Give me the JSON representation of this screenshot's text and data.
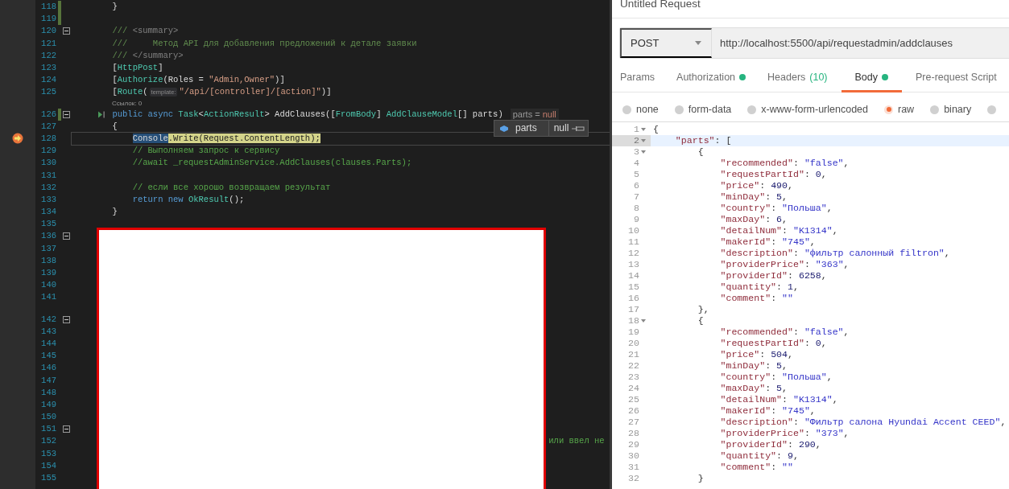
{
  "editor": {
    "lines": [
      {
        "number": "118",
        "changed": true,
        "fold": false,
        "current": false,
        "tokens": [
          {
            "kind": "plain",
            "text": "        }"
          }
        ]
      },
      {
        "number": "119",
        "changed": true,
        "fold": false,
        "current": false
      },
      {
        "number": "120",
        "changed": false,
        "fold": true,
        "current": false,
        "tokens": [
          {
            "kind": "doc",
            "text": "        ///"
          },
          {
            "kind": "doctag",
            "text": " <summary>"
          }
        ]
      },
      {
        "number": "121",
        "changed": false,
        "fold": false,
        "current": false,
        "tokens": [
          {
            "kind": "doc",
            "text": "        ///     Метод API для добавления предложений к детале заявки"
          }
        ]
      },
      {
        "number": "122",
        "changed": false,
        "fold": false,
        "current": false,
        "tokens": [
          {
            "kind": "doc",
            "text": "        ///"
          },
          {
            "kind": "doctag",
            "text": " </summary>"
          }
        ]
      },
      {
        "number": "123",
        "changed": false,
        "fold": false,
        "current": false,
        "tokens": [
          {
            "kind": "plain",
            "text": "        ["
          },
          {
            "kind": "type",
            "text": "HttpPost"
          },
          {
            "kind": "plain",
            "text": "]"
          }
        ]
      },
      {
        "number": "124",
        "changed": false,
        "fold": false,
        "current": false,
        "tokens": [
          {
            "kind": "plain",
            "text": "        ["
          },
          {
            "kind": "type",
            "text": "Authorize"
          },
          {
            "kind": "plain",
            "text": "(Roles = "
          },
          {
            "kind": "string",
            "text": "\"Admin,Owner\""
          },
          {
            "kind": "plain",
            "text": ")]"
          }
        ]
      },
      {
        "number": "125",
        "changed": false,
        "fold": false,
        "current": false,
        "tokens": [
          {
            "kind": "plain",
            "text": "        ["
          },
          {
            "kind": "type",
            "text": "Route"
          },
          {
            "kind": "plain",
            "text": "("
          },
          {
            "kind": "param-hint",
            "text": "template:"
          },
          {
            "kind": "string",
            "text": "\"/api/[controller]/[action]\""
          },
          {
            "kind": "plain",
            "text": ")]"
          }
        ]
      },
      {
        "number": "126",
        "changed": true,
        "fold": true,
        "current": false,
        "lens": "Ссылок: 0",
        "run_icon": true,
        "tokens": [
          {
            "kind": "keyword",
            "text": "        public async "
          },
          {
            "kind": "type",
            "text": "Task"
          },
          {
            "kind": "plain",
            "text": "<"
          },
          {
            "kind": "type",
            "text": "ActionResult"
          },
          {
            "kind": "plain",
            "text": "> AddClauses(["
          },
          {
            "kind": "type",
            "text": "FromBody"
          },
          {
            "kind": "plain",
            "text": "] "
          },
          {
            "kind": "type",
            "text": "AddClauseModel"
          },
          {
            "kind": "plain",
            "text": "[] parts)"
          },
          {
            "kind": "value-hint-name",
            "text": "parts = "
          },
          {
            "kind": "value-hint-null",
            "text": "null"
          }
        ]
      },
      {
        "number": "127",
        "changed": false,
        "fold": false,
        "current": false,
        "tokens": [
          {
            "kind": "plain",
            "text": "        {"
          }
        ]
      },
      {
        "number": "128",
        "changed": false,
        "fold": false,
        "current": true,
        "tokens": [
          {
            "kind": "selected",
            "text": "            Console"
          },
          {
            "kind": "statement",
            "text": ".Write(Request.ContentLength);"
          }
        ]
      },
      {
        "number": "129",
        "changed": false,
        "fold": false,
        "current": false,
        "tokens": [
          {
            "kind": "comment",
            "text": "            // Выполняем запрос к сервису"
          }
        ]
      },
      {
        "number": "130",
        "changed": false,
        "fold": false,
        "current": false,
        "tokens": [
          {
            "kind": "comment",
            "text": "            //await _requestAdminService.AddClauses(clauses.Parts);"
          }
        ]
      },
      {
        "number": "131",
        "changed": false,
        "fold": false,
        "current": false
      },
      {
        "number": "132",
        "changed": false,
        "fold": false,
        "current": false,
        "tokens": [
          {
            "kind": "comment",
            "text": "            // если все хорошо возвращаем результат"
          }
        ]
      },
      {
        "number": "133",
        "changed": false,
        "fold": false,
        "current": false,
        "tokens": [
          {
            "kind": "keyword",
            "text": "            return new "
          },
          {
            "kind": "type",
            "text": "OkResult"
          },
          {
            "kind": "plain",
            "text": "();"
          }
        ]
      },
      {
        "number": "134",
        "changed": false,
        "fold": false,
        "current": false,
        "tokens": [
          {
            "kind": "plain",
            "text": "        }"
          }
        ]
      },
      {
        "number": "135",
        "changed": false,
        "fold": false,
        "current": false
      },
      {
        "number": "136",
        "changed": false,
        "fold": true,
        "current": false
      },
      {
        "number": "137",
        "changed": false,
        "fold": false,
        "current": false
      },
      {
        "number": "138",
        "changed": false,
        "fold": false,
        "current": false
      },
      {
        "number": "139",
        "changed": false,
        "fold": false,
        "current": false
      },
      {
        "number": "140",
        "changed": false,
        "fold": false,
        "current": false
      },
      {
        "number": "141",
        "changed": false,
        "fold": false,
        "current": false
      },
      {
        "number": "142",
        "changed": false,
        "fold": true,
        "current": false,
        "lens_hidden": true
      },
      {
        "number": "143",
        "changed": false,
        "fold": false,
        "current": false
      },
      {
        "number": "144",
        "changed": false,
        "fold": false,
        "current": false
      },
      {
        "number": "145",
        "changed": false,
        "fold": false,
        "current": false
      },
      {
        "number": "146",
        "changed": false,
        "fold": false,
        "current": false
      },
      {
        "number": "147",
        "changed": false,
        "fold": false,
        "current": false
      },
      {
        "number": "148",
        "changed": false,
        "fold": false,
        "current": false
      },
      {
        "number": "149",
        "changed": false,
        "fold": false,
        "current": false
      },
      {
        "number": "150",
        "changed": false,
        "fold": false,
        "current": false
      },
      {
        "number": "151",
        "changed": false,
        "fold": true,
        "current": false
      },
      {
        "number": "152",
        "changed": false,
        "fold": false,
        "current": false,
        "tokens": [
          {
            "kind": "comment",
            "text": "                                                                                              или ввел не"
          }
        ]
      },
      {
        "number": "153",
        "changed": false,
        "fold": false,
        "current": false
      },
      {
        "number": "154",
        "changed": false,
        "fold": false,
        "current": false
      },
      {
        "number": "155",
        "changed": false,
        "fold": false,
        "current": false
      }
    ],
    "datatip": {
      "name": "parts",
      "value": "null"
    }
  },
  "request": {
    "title": "Untitled Request",
    "method": "POST",
    "url": "http://localhost:5500/api/requestadmin/addclauses",
    "tabs": [
      {
        "label": "Params",
        "selected": false,
        "indicator": false
      },
      {
        "label": "Authorization",
        "selected": false,
        "indicator": true
      },
      {
        "label": "Headers",
        "count": "(10)",
        "selected": false,
        "indicator": false
      },
      {
        "label": "Body",
        "selected": true,
        "indicator": true
      },
      {
        "label": "Pre-request Script",
        "selected": false,
        "indicator": false
      }
    ],
    "body_types": [
      {
        "label": "none",
        "selected": false
      },
      {
        "label": "form-data",
        "selected": false
      },
      {
        "label": "x-www-form-urlencoded",
        "selected": false
      },
      {
        "label": "raw",
        "selected": true
      },
      {
        "label": "binary",
        "selected": false
      },
      {
        "selected": false
      }
    ],
    "body": [
      {
        "number": "1",
        "fold": true,
        "active": false,
        "tokens": [
          {
            "kind": "punct",
            "text": "{"
          }
        ]
      },
      {
        "number": "2",
        "fold": true,
        "active": true,
        "tokens": [
          {
            "kind": "key",
            "text": "    \"parts\""
          },
          {
            "kind": "punct",
            "text": ": ["
          }
        ]
      },
      {
        "number": "3",
        "fold": true,
        "active": false,
        "tokens": [
          {
            "kind": "punct",
            "text": "        {"
          }
        ]
      },
      {
        "number": "4",
        "fold": false,
        "active": false,
        "tokens": [
          {
            "kind": "key",
            "text": "            \"recommended\""
          },
          {
            "kind": "punct",
            "text": ": "
          },
          {
            "kind": "str",
            "text": "\"false\""
          },
          {
            "kind": "punct",
            "text": ","
          }
        ]
      },
      {
        "number": "5",
        "fold": false,
        "active": false,
        "tokens": [
          {
            "kind": "key",
            "text": "            \"requestPartId\""
          },
          {
            "kind": "punct",
            "text": ": "
          },
          {
            "kind": "num",
            "text": "0"
          },
          {
            "kind": "punct",
            "text": ","
          }
        ]
      },
      {
        "number": "6",
        "fold": false,
        "active": false,
        "tokens": [
          {
            "kind": "key",
            "text": "            \"price\""
          },
          {
            "kind": "punct",
            "text": ": "
          },
          {
            "kind": "num",
            "text": "490"
          },
          {
            "kind": "punct",
            "text": ","
          }
        ]
      },
      {
        "number": "7",
        "fold": false,
        "active": false,
        "tokens": [
          {
            "kind": "key",
            "text": "            \"minDay\""
          },
          {
            "kind": "punct",
            "text": ": "
          },
          {
            "kind": "num",
            "text": "5"
          },
          {
            "kind": "punct",
            "text": ","
          }
        ]
      },
      {
        "number": "8",
        "fold": false,
        "active": false,
        "tokens": [
          {
            "kind": "key",
            "text": "            \"country\""
          },
          {
            "kind": "punct",
            "text": ": "
          },
          {
            "kind": "str",
            "text": "\"Польша\""
          },
          {
            "kind": "punct",
            "text": ","
          }
        ]
      },
      {
        "number": "9",
        "fold": false,
        "active": false,
        "tokens": [
          {
            "kind": "key",
            "text": "            \"maxDay\""
          },
          {
            "kind": "punct",
            "text": ": "
          },
          {
            "kind": "num",
            "text": "6"
          },
          {
            "kind": "punct",
            "text": ","
          }
        ]
      },
      {
        "number": "10",
        "fold": false,
        "active": false,
        "tokens": [
          {
            "kind": "key",
            "text": "            \"detailNum\""
          },
          {
            "kind": "punct",
            "text": ": "
          },
          {
            "kind": "str",
            "text": "\"K1314\""
          },
          {
            "kind": "punct",
            "text": ","
          }
        ]
      },
      {
        "number": "11",
        "fold": false,
        "active": false,
        "tokens": [
          {
            "kind": "key",
            "text": "            \"makerId\""
          },
          {
            "kind": "punct",
            "text": ": "
          },
          {
            "kind": "str",
            "text": "\"745\""
          },
          {
            "kind": "punct",
            "text": ","
          }
        ]
      },
      {
        "number": "12",
        "fold": false,
        "active": false,
        "tokens": [
          {
            "kind": "key",
            "text": "            \"description\""
          },
          {
            "kind": "punct",
            "text": ": "
          },
          {
            "kind": "str",
            "text": "\"фильтр салонный filtron\""
          },
          {
            "kind": "punct",
            "text": ","
          }
        ]
      },
      {
        "number": "13",
        "fold": false,
        "active": false,
        "tokens": [
          {
            "kind": "key",
            "text": "            \"providerPrice\""
          },
          {
            "kind": "punct",
            "text": ": "
          },
          {
            "kind": "str",
            "text": "\"363\""
          },
          {
            "kind": "punct",
            "text": ","
          }
        ]
      },
      {
        "number": "14",
        "fold": false,
        "active": false,
        "tokens": [
          {
            "kind": "key",
            "text": "            \"providerId\""
          },
          {
            "kind": "punct",
            "text": ": "
          },
          {
            "kind": "num",
            "text": "6258"
          },
          {
            "kind": "punct",
            "text": ","
          }
        ]
      },
      {
        "number": "15",
        "fold": false,
        "active": false,
        "tokens": [
          {
            "kind": "key",
            "text": "            \"quantity\""
          },
          {
            "kind": "punct",
            "text": ": "
          },
          {
            "kind": "num",
            "text": "1"
          },
          {
            "kind": "punct",
            "text": ","
          }
        ]
      },
      {
        "number": "16",
        "fold": false,
        "active": false,
        "tokens": [
          {
            "kind": "key",
            "text": "            \"comment\""
          },
          {
            "kind": "punct",
            "text": ": "
          },
          {
            "kind": "str",
            "text": "\"\""
          }
        ]
      },
      {
        "number": "17",
        "fold": false,
        "active": false,
        "tokens": [
          {
            "kind": "punct",
            "text": "        },"
          }
        ]
      },
      {
        "number": "18",
        "fold": true,
        "active": false,
        "tokens": [
          {
            "kind": "punct",
            "text": "        {"
          }
        ]
      },
      {
        "number": "19",
        "fold": false,
        "active": false,
        "tokens": [
          {
            "kind": "key",
            "text": "            \"recommended\""
          },
          {
            "kind": "punct",
            "text": ": "
          },
          {
            "kind": "str",
            "text": "\"false\""
          },
          {
            "kind": "punct",
            "text": ","
          }
        ]
      },
      {
        "number": "20",
        "fold": false,
        "active": false,
        "tokens": [
          {
            "kind": "key",
            "text": "            \"requestPartId\""
          },
          {
            "kind": "punct",
            "text": ": "
          },
          {
            "kind": "num",
            "text": "0"
          },
          {
            "kind": "punct",
            "text": ","
          }
        ]
      },
      {
        "number": "21",
        "fold": false,
        "active": false,
        "tokens": [
          {
            "kind": "key",
            "text": "            \"price\""
          },
          {
            "kind": "punct",
            "text": ": "
          },
          {
            "kind": "num",
            "text": "504"
          },
          {
            "kind": "punct",
            "text": ","
          }
        ]
      },
      {
        "number": "22",
        "fold": false,
        "active": false,
        "tokens": [
          {
            "kind": "key",
            "text": "            \"minDay\""
          },
          {
            "kind": "punct",
            "text": ": "
          },
          {
            "kind": "num",
            "text": "5"
          },
          {
            "kind": "punct",
            "text": ","
          }
        ]
      },
      {
        "number": "23",
        "fold": false,
        "active": false,
        "tokens": [
          {
            "kind": "key",
            "text": "            \"country\""
          },
          {
            "kind": "punct",
            "text": ": "
          },
          {
            "kind": "str",
            "text": "\"Польша\""
          },
          {
            "kind": "punct",
            "text": ","
          }
        ]
      },
      {
        "number": "24",
        "fold": false,
        "active": false,
        "tokens": [
          {
            "kind": "key",
            "text": "            \"maxDay\""
          },
          {
            "kind": "punct",
            "text": ": "
          },
          {
            "kind": "num",
            "text": "5"
          },
          {
            "kind": "punct",
            "text": ","
          }
        ]
      },
      {
        "number": "25",
        "fold": false,
        "active": false,
        "tokens": [
          {
            "kind": "key",
            "text": "            \"detailNum\""
          },
          {
            "kind": "punct",
            "text": ": "
          },
          {
            "kind": "str",
            "text": "\"K1314\""
          },
          {
            "kind": "punct",
            "text": ","
          }
        ]
      },
      {
        "number": "26",
        "fold": false,
        "active": false,
        "tokens": [
          {
            "kind": "key",
            "text": "            \"makerId\""
          },
          {
            "kind": "punct",
            "text": ": "
          },
          {
            "kind": "str",
            "text": "\"745\""
          },
          {
            "kind": "punct",
            "text": ","
          }
        ]
      },
      {
        "number": "27",
        "fold": false,
        "active": false,
        "tokens": [
          {
            "kind": "key",
            "text": "            \"description\""
          },
          {
            "kind": "punct",
            "text": ": "
          },
          {
            "kind": "str",
            "text": "\"Фильтр салона Hyundai Accent CEED\""
          },
          {
            "kind": "punct",
            "text": ","
          }
        ]
      },
      {
        "number": "28",
        "fold": false,
        "active": false,
        "tokens": [
          {
            "kind": "key",
            "text": "            \"providerPrice\""
          },
          {
            "kind": "punct",
            "text": ": "
          },
          {
            "kind": "str",
            "text": "\"373\""
          },
          {
            "kind": "punct",
            "text": ","
          }
        ]
      },
      {
        "number": "29",
        "fold": false,
        "active": false,
        "tokens": [
          {
            "kind": "key",
            "text": "            \"providerId\""
          },
          {
            "kind": "punct",
            "text": ": "
          },
          {
            "kind": "num",
            "text": "290"
          },
          {
            "kind": "punct",
            "text": ","
          }
        ]
      },
      {
        "number": "30",
        "fold": false,
        "active": false,
        "tokens": [
          {
            "kind": "key",
            "text": "            \"quantity\""
          },
          {
            "kind": "punct",
            "text": ": "
          },
          {
            "kind": "num",
            "text": "9"
          },
          {
            "kind": "punct",
            "text": ","
          }
        ]
      },
      {
        "number": "31",
        "fold": false,
        "active": false,
        "tokens": [
          {
            "kind": "key",
            "text": "            \"comment\""
          },
          {
            "kind": "punct",
            "text": ": "
          },
          {
            "kind": "str",
            "text": "\"\""
          }
        ]
      },
      {
        "number": "32",
        "fold": false,
        "active": false,
        "tokens": [
          {
            "kind": "punct",
            "text": "        }"
          }
        ]
      }
    ]
  }
}
